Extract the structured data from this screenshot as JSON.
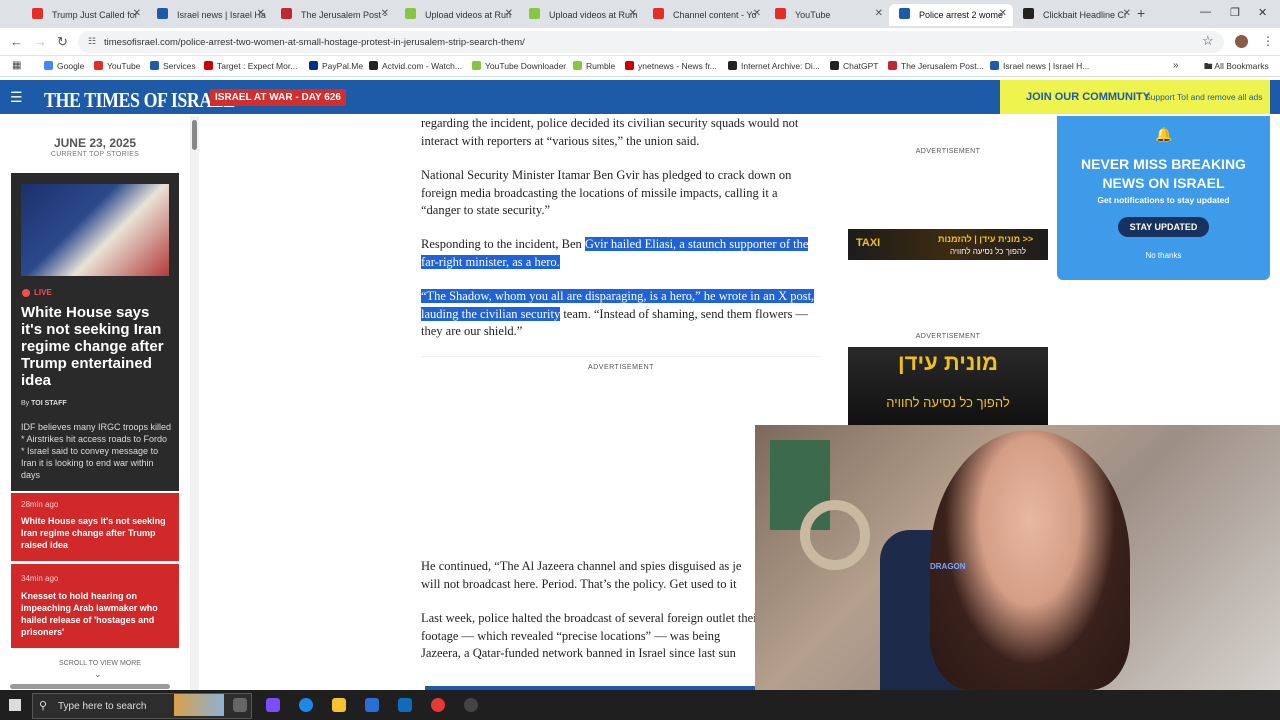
{
  "browser": {
    "tabs": [
      {
        "label": "Trump Just Called for",
        "color": "#e52d27"
      },
      {
        "label": "Israel news | Israel Ha",
        "color": "#1d5ba8"
      },
      {
        "label": "The Jerusalem Post -",
        "color": "#c0282d"
      },
      {
        "label": "Upload videos at Run",
        "color": "#85c742"
      },
      {
        "label": "Upload videos at Rum",
        "color": "#85c742"
      },
      {
        "label": "Channel content - Yo",
        "color": "#e52d27"
      },
      {
        "label": "YouTube",
        "color": "#e52d27"
      },
      {
        "label": "Police arrest 2 wome",
        "color": "#1d5ba8"
      },
      {
        "label": "Clickbait Headline Cr",
        "color": "#222222"
      }
    ],
    "url": "timesofisrael.com/police-arrest-two-women-at-small-hostage-protest-in-jerusalem-strip-search-them/",
    "bookmarks": [
      {
        "label": "Google",
        "color": "#4285f4"
      },
      {
        "label": "YouTube",
        "color": "#e52d27"
      },
      {
        "label": "Services",
        "color": "#1d5ba8"
      },
      {
        "label": "Target : Expect Mor...",
        "color": "#cc0000"
      },
      {
        "label": "PayPal.Me",
        "color": "#003087"
      },
      {
        "label": "Actvid.com - Watch...",
        "color": "#222222"
      },
      {
        "label": "YouTube Downloader",
        "color": "#85c742"
      },
      {
        "label": "Rumble",
        "color": "#85c742"
      },
      {
        "label": "ynetnews - News fr...",
        "color": "#cc0000"
      },
      {
        "label": "Internet Archive: Di...",
        "color": "#222222"
      },
      {
        "label": "ChatGPT",
        "color": "#222222"
      },
      {
        "label": "The Jerusalem Post...",
        "color": "#c0282d"
      },
      {
        "label": "Israel news | Israel H...",
        "color": "#1d5ba8"
      }
    ],
    "all_bookmarks": "All Bookmarks"
  },
  "site": {
    "logo": "THE TIMES OF ISRAEL",
    "war_badge": "ISRAEL AT WAR - DAY 626",
    "join_title": "JOIN OUR COMMUNITY",
    "join_sub": "Support ToI and remove all ads"
  },
  "sidebar": {
    "date": "JUNE 23, 2025",
    "date_sub": "CURRENT TOP STORIES",
    "live": "LIVE",
    "headline": "White House says it's not seeking Iran regime change after Trump entertained idea",
    "by": "By",
    "byline": "TOI STAFF",
    "summary": "IDF believes many IRGC troops killed * Airstrikes hit access roads to Fordo * Israel said to convey message to Iran it is looking to end war within days",
    "items": [
      {
        "time": "28min ago",
        "title": "White House says it's not seeking Iran regime change after Trump raised idea"
      },
      {
        "time": "34min ago",
        "title": "Knesset to hold hearing on impeaching Arab lawmaker who hailed release of 'hostages and prisoners'"
      }
    ],
    "scroll": "SCROLL TO VIEW MORE"
  },
  "article": {
    "p1": "regarding the incident, police decided its civilian security squads would not interact with reporters at “various sites,” the union said.",
    "p2": "National Security Minister Itamar Ben Gvir has pledged to crack down on foreign media broadcasting the locations of missile impacts, calling it a “danger to state security.”",
    "p3_plain": "Responding to the incident, Ben ",
    "p3_hl": "Gvir hailed Eliasi, a staunch supporter of the far-right minister, as a hero.",
    "p4_hl": "“The Shadow, whom you all are disparaging, is a hero,” he wrote in an X post, lauding the civilian security",
    "p4_plain": " team. “Instead of shaming, send them flowers — they are our shield.”",
    "ad_label": "ADVERTISEMENT",
    "p5": "He continued, “The Al Jazeera channel and spies disguised as je will not broadcast here. Period. That’s the policy. Get used to it",
    "p6": "Last week, police halted the broadcast of several foreign outlet their footage — which revealed “precise locations” — was being Jazeera, a Qatar-funded network banned in Israel since last sun"
  },
  "ads": {
    "label": "ADVERTISEMENT",
    "ad1_a": "TAXI",
    "ad1_b": "מונית עידן | להזמנות >>",
    "ad1_c": "להפוך כל נסיעה לחוויה",
    "ad2_a": "מונית עידן",
    "ad2_b": "להפוך כל נסיעה לחוויה"
  },
  "popup": {
    "title": "NEVER MISS BREAKING NEWS ON ISRAEL",
    "sub": "Get notifications to stay updated",
    "button": "STAY UPDATED",
    "dismiss": "No thanks"
  },
  "webcam": {
    "chair_text": "DRAGON"
  },
  "taskbar": {
    "search_placeholder": "Type here to search"
  }
}
